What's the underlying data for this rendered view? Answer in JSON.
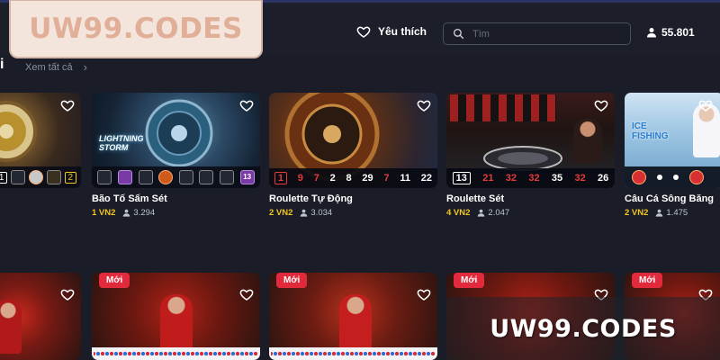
{
  "header": {
    "logo_text": "UW99.CODES",
    "favorites_label": "Yêu thích",
    "search_placeholder": "Tìm",
    "balance": "55.801"
  },
  "section": {
    "title": "i",
    "see_all": "Xem tất cả"
  },
  "games_row1": [
    {
      "name": "",
      "price": "",
      "players": "",
      "numbers": [
        "1",
        "2"
      ]
    },
    {
      "name": "Bão Tố Sấm Sét",
      "price": "1 VN2",
      "players": "3.294",
      "chip_number": "13"
    },
    {
      "name": "Roulette Tự Động",
      "price": "2 VN2",
      "players": "3.034",
      "numbers": [
        "1",
        "9",
        "7",
        "2",
        "8",
        "29",
        "7",
        "11",
        "22"
      ]
    },
    {
      "name": "Roulette Sét",
      "price": "4 VN2",
      "players": "2.047",
      "numbers": [
        "13",
        "21",
        "32",
        "32",
        "35",
        "32",
        "26"
      ]
    },
    {
      "name": "Câu Cá Sông Băng",
      "price": "2 VN2",
      "players": "1.475"
    }
  ],
  "games_row2": [
    {
      "badge": ""
    },
    {
      "badge": "Mới"
    },
    {
      "badge": "Mới"
    },
    {
      "badge": "Mới"
    },
    {
      "badge": "Mới"
    }
  ],
  "watermark": "UW99.CODES",
  "colors": {
    "background": "#1a1d27",
    "price_yellow": "#f2c61f",
    "badge_red": "#e22a3d",
    "logo_pink": "#e1ae98"
  }
}
